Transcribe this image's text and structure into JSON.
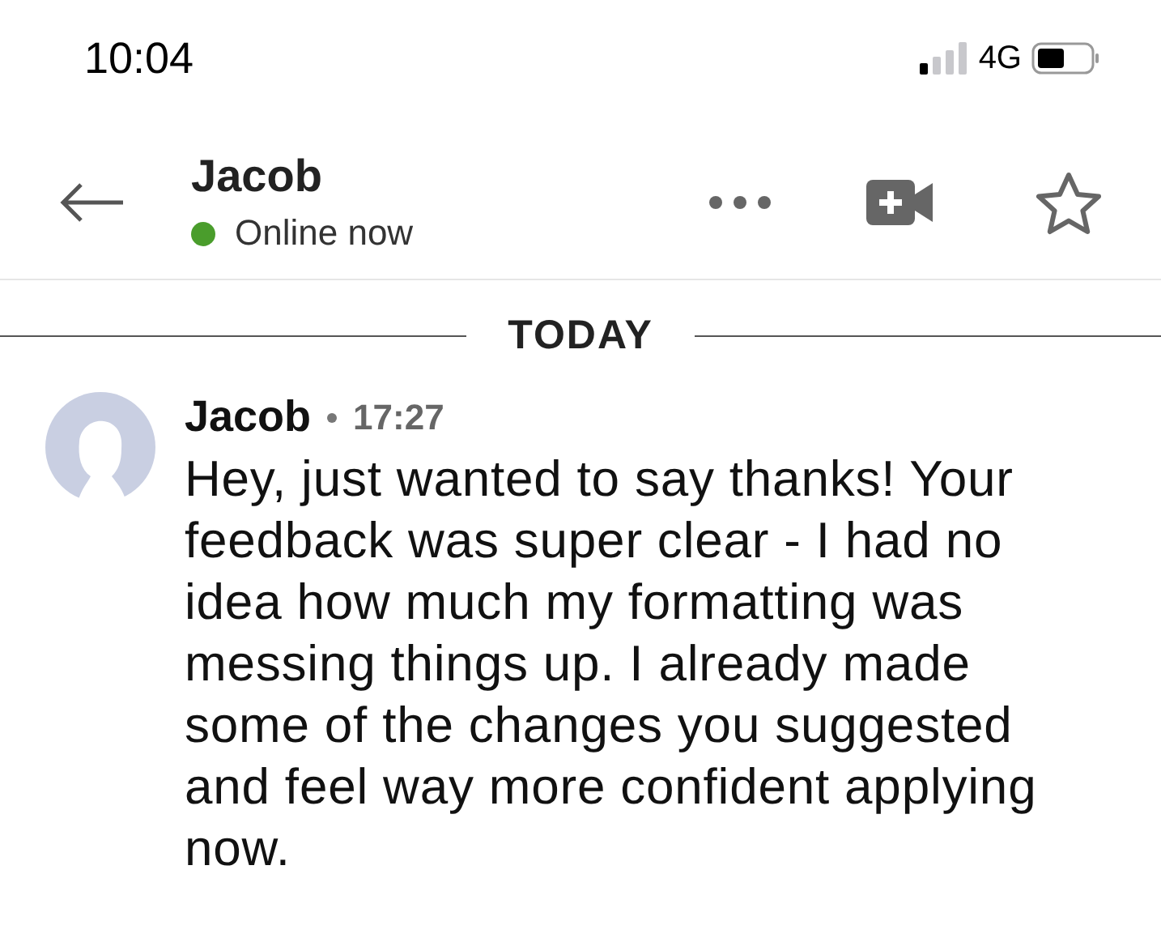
{
  "status_bar": {
    "time": "10:04",
    "network": "4G"
  },
  "header": {
    "name": "Jacob",
    "online": true,
    "status": "Online now"
  },
  "date_divider": "TODAY",
  "messages": [
    {
      "sender": "Jacob",
      "time": "17:27",
      "text": "Hey, just wanted to say thanks! Your feedback was super clear - I had no idea how much my formatting was messing things up. I already made some of the changes you suggested and feel way more confident applying now."
    }
  ]
}
